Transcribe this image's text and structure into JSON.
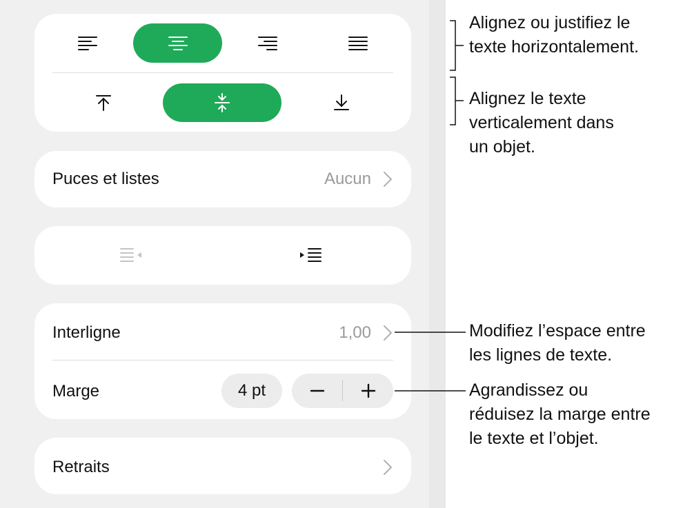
{
  "panel": {
    "bullets_row": {
      "label": "Puces et listes",
      "value": "Aucun"
    },
    "spacing_row": {
      "label": "Interligne",
      "value": "1,00"
    },
    "margin_row": {
      "label": "Marge",
      "value": "4 pt",
      "decrement": "−",
      "increment": "+"
    },
    "indents_row": {
      "label": "Retraits"
    },
    "horizontal_align": {
      "options": [
        "left",
        "center",
        "right",
        "justify"
      ],
      "selected": "center"
    },
    "vertical_align": {
      "options": [
        "top",
        "middle",
        "bottom"
      ],
      "selected": "middle"
    },
    "indent_buttons": {
      "decrease_enabled": false,
      "increase_enabled": true
    },
    "colors": {
      "accent": "#1faa59",
      "panel_bg": "#f0f0f0",
      "card_bg": "#ffffff",
      "secondary_text": "#9a9a9a"
    }
  },
  "callouts": {
    "horizontal": [
      "Alignez ou justifiez le",
      "texte horizontalement."
    ],
    "vertical": [
      "Alignez le texte",
      "verticalement dans",
      "un objet."
    ],
    "spacing": [
      "Modifiez l’espace entre",
      "les lignes de texte."
    ],
    "margin": [
      "Agrandissez ou",
      "réduisez la marge entre",
      "le texte et l’objet."
    ]
  }
}
